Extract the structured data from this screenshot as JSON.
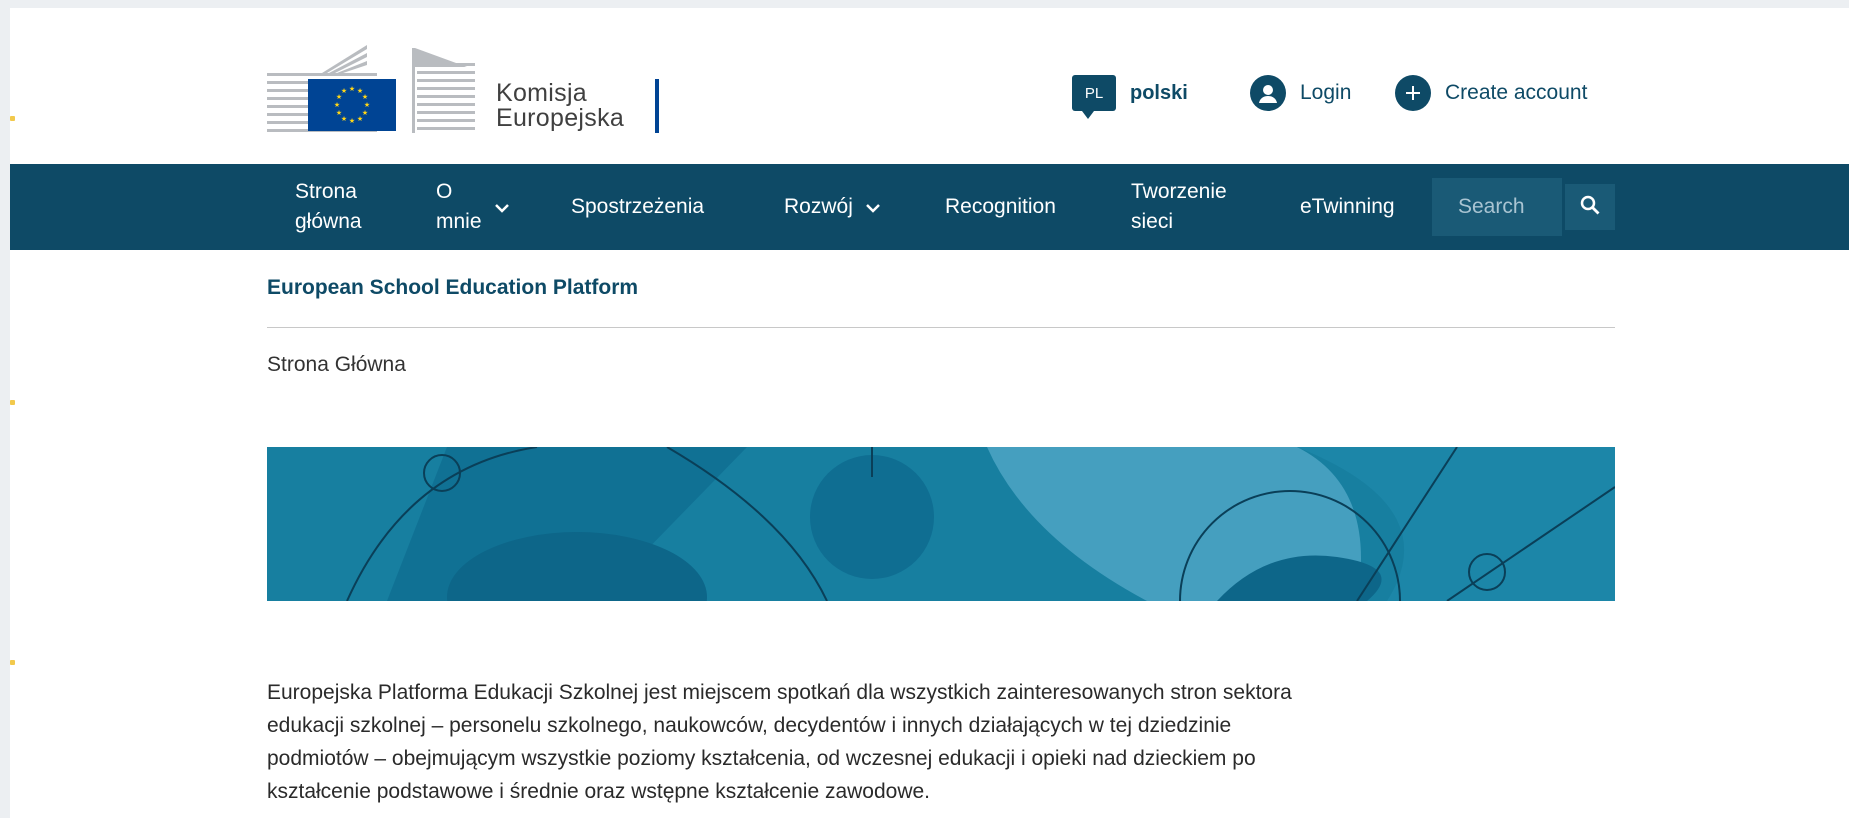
{
  "brand": {
    "name_line1": "Komisja",
    "name_line2": "Europejska"
  },
  "top_actions": {
    "language_code": "PL",
    "language_label": "polski",
    "login_label": "Login",
    "create_account_label": "Create account",
    "login_icon": "user-icon",
    "create_icon": "plus-icon"
  },
  "nav": {
    "items": [
      {
        "label_line1": "Strona",
        "label_line2": "główna",
        "has_dropdown": false
      },
      {
        "label_line1": "O",
        "label_line2": "mnie",
        "has_dropdown": true
      },
      {
        "label_line1": "Spostrzeżenia",
        "label_line2": "",
        "has_dropdown": false
      },
      {
        "label_line1": "Rozwój",
        "label_line2": "",
        "has_dropdown": true
      },
      {
        "label_line1": "Recognition",
        "label_line2": "",
        "has_dropdown": false
      },
      {
        "label_line1": "Tworzenie",
        "label_line2": "sieci",
        "has_dropdown": false
      },
      {
        "label_line1": "eTwinning",
        "label_line2": "",
        "has_dropdown": false
      }
    ],
    "search_placeholder": "Search",
    "search_icon": "search-icon"
  },
  "site_title": "European School Education Platform",
  "breadcrumb": "Strona Główna",
  "intro_text": "Europejska Platforma Edukacji Szkolnej jest miejscem spotkań dla wszystkich zainteresowanych stron sektora edukacji szkolnej – personelu szkolnego, naukowców, decydentów i innych działających w tej dziedzinie podmiotów – obejmującym wszystkie poziomy kształcenia, od wczesnej edukacji i opieki nad dzieckiem po kształcenie podstawowe i średnie oraz wstępne kształcenie zawodowe.",
  "colors": {
    "primary": "#0e4a66",
    "banner": "#177fa0",
    "eu_blue": "#004494",
    "eu_gold": "#ffd617"
  }
}
